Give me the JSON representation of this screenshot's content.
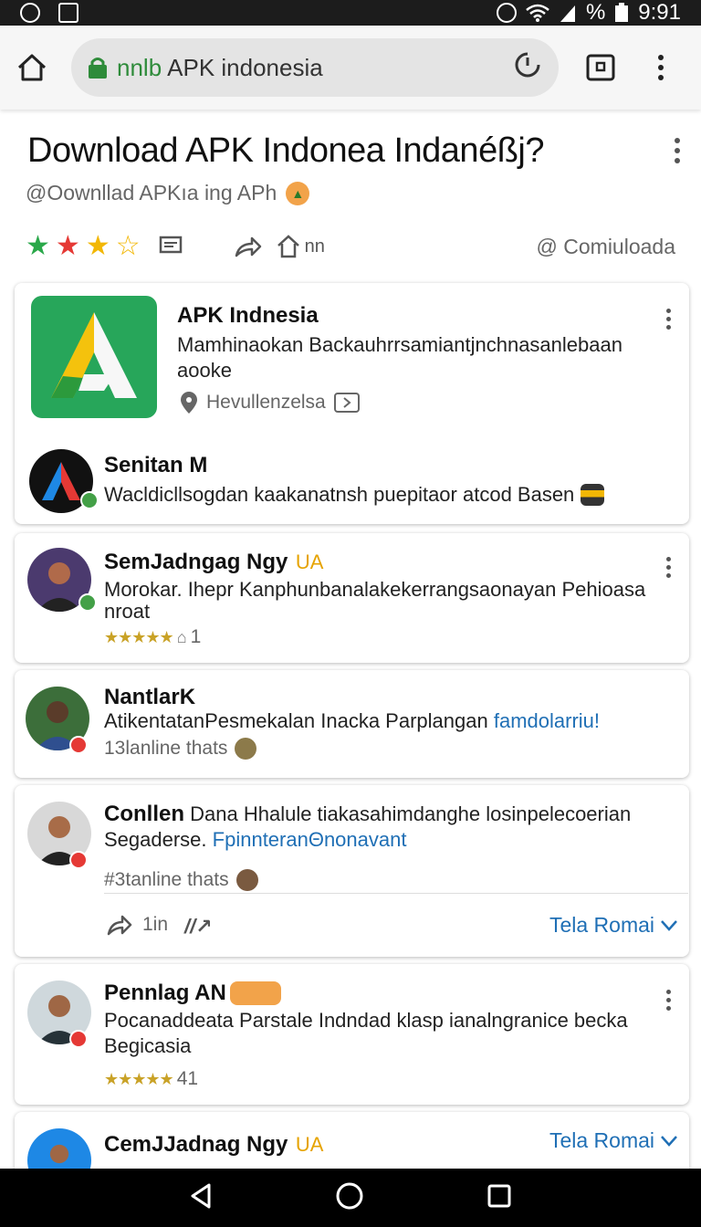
{
  "status_bar": {
    "percent": "%",
    "time": "9:91"
  },
  "browser": {
    "url_secure": "nnlb",
    "url_rest": "APK indonesia"
  },
  "header": {
    "title": "Download APK Indonea Indanéßj?",
    "subtitle": "@Oownllad APKıa ing APh"
  },
  "actions": {
    "share_label": "nn",
    "download_label": "@ Comiuloada"
  },
  "colors": {
    "accent_green": "#27a65a",
    "link_blue": "#1f6fb5",
    "star_gold": "#f2b705"
  },
  "app_card": {
    "name": "APK Indnesia",
    "description": "Mamhinaokan Backauhrrsamiantjnchnasanlebaan aooke",
    "location": "Hevullenzelsa",
    "sub_name": "Senitan M",
    "sub_text": "Wacldicllsogdan kaakanatnsh puepitaor atcod Basen"
  },
  "comments": [
    {
      "name": "SemJadngag Ngy",
      "tag": "UA",
      "text": "Morokar. Ihepr Kanphunbanalakekerrangsaonayan Pehioasa nroat",
      "rating_text": "1"
    },
    {
      "name": "NantlarK",
      "text": "AtikentatanPesmekalan Inacka Parplangan",
      "link": "famdolarriu!",
      "meta": "13lanline thats"
    },
    {
      "name": "Conllen",
      "text": "Dana Hhalule tiakasahimdanghe losinpelecoerian Segaderse.",
      "link": "FpinnteranΘnonavant",
      "meta": "#3tanline thats",
      "reply_count": "1in",
      "expand_label": "Tela Romai"
    },
    {
      "name": "Pennlag AN",
      "text": "Pocanaddeata Parstale Indndad klasp ianalngranice becka Begicasia",
      "rating_text": "41"
    },
    {
      "name": "CemJJadnag Ngy",
      "tag": "UA",
      "expand_label": "Tela Romai"
    }
  ]
}
